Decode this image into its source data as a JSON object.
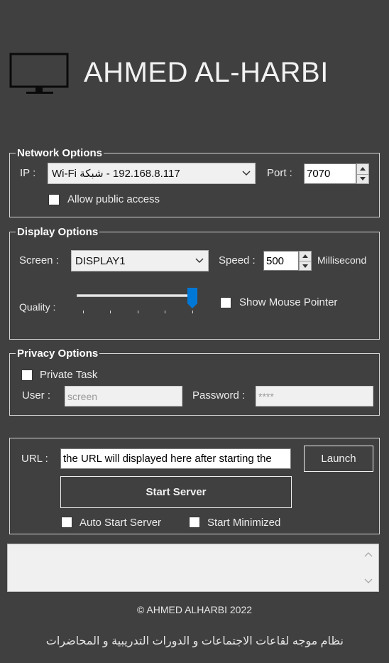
{
  "header": {
    "title": "AHMED AL-HARBI"
  },
  "network": {
    "legend": "Network Options",
    "ip_label": "IP :",
    "ip_value": "192.168.8.117 - شبكة Wi-Fi",
    "port_label": "Port :",
    "port_value": "7070",
    "allow_public_label": "Allow public access",
    "allow_public_checked": false
  },
  "display": {
    "legend": "Display Options",
    "screen_label": "Screen :",
    "screen_value": "DISPLAY1",
    "speed_label": "Speed :",
    "speed_value": "500",
    "speed_unit": "Millisecond",
    "quality_label": "Quality :",
    "quality_level_fraction": 1.0,
    "show_pointer_label": "Show Mouse Pointer",
    "show_pointer_checked": false
  },
  "privacy": {
    "legend": "Privacy Options",
    "private_task_label": "Private Task",
    "private_task_checked": false,
    "user_label": "User :",
    "user_value": "screen",
    "password_label": "Password :",
    "password_value": "****"
  },
  "server": {
    "url_label": "URL :",
    "url_value": "the URL will displayed here after starting the",
    "launch_label": "Launch",
    "start_label": "Start Server",
    "auto_start_label": "Auto Start Server",
    "start_minimized_label": "Start Minimized"
  },
  "footer": {
    "copyright": "© AHMED ALHARBI 2022",
    "arabic_tagline": "نظام موجه لقاعات الاجتماعات و الدورات التدريبية و المحاضرات"
  },
  "colors": {
    "background": "#404040",
    "slider_thumb": "#0078d7",
    "text": "#ececec"
  }
}
